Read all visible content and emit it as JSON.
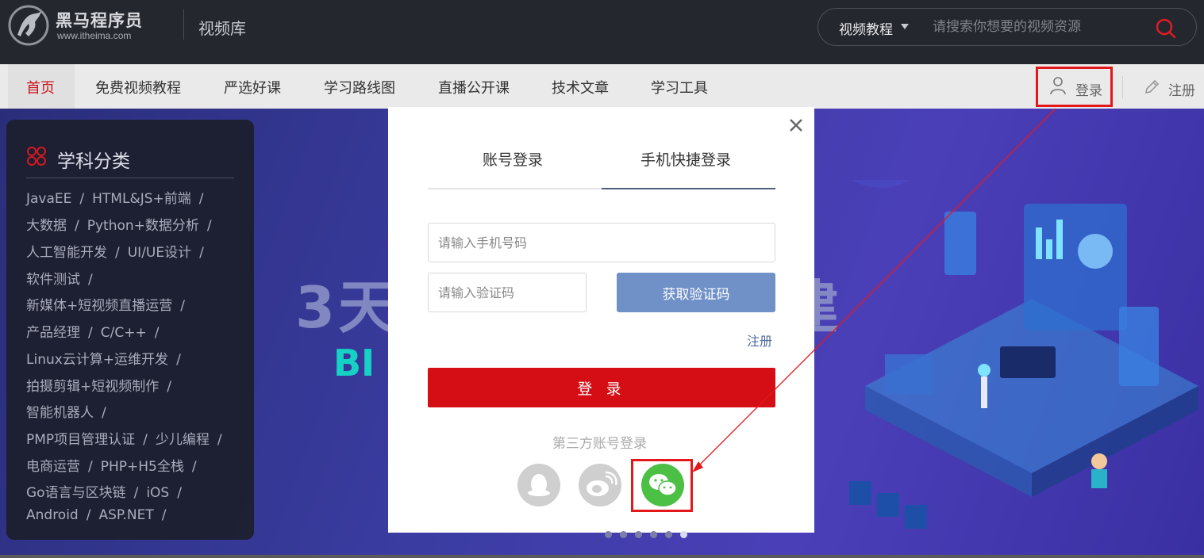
{
  "header": {
    "brand_cn": "黑马程序员",
    "brand_url": "www.itheima.com",
    "section_title": "视频库",
    "search": {
      "category": "视频教程",
      "placeholder": "请搜索你想要的视频资源"
    }
  },
  "nav": {
    "items": [
      "首页",
      "免费视频教程",
      "严选好课",
      "学习路线图",
      "直播公开课",
      "技术文章",
      "学习工具"
    ],
    "active": "首页",
    "login": "登录",
    "register": "注册"
  },
  "sidebar": {
    "title": "学科分类",
    "lines": [
      [
        "JavaEE",
        "HTML&JS+前端"
      ],
      [
        "大数据",
        "Python+数据分析"
      ],
      [
        "人工智能开发",
        "UI/UE设计"
      ],
      [
        "软件测试"
      ],
      [
        "新媒体+短视频直播运营"
      ],
      [
        "产品经理",
        "C/C++"
      ],
      [
        "Linux云计算+运维开发"
      ],
      [
        "拍摄剪辑+短视频制作"
      ],
      [
        "智能机器人"
      ],
      [
        "PMP项目管理认证",
        "少儿编程"
      ],
      [
        "电商运营",
        "PHP+H5全栈"
      ],
      [
        "Go语言与区块链",
        "iOS"
      ],
      [
        "Android",
        "ASP.NET"
      ]
    ]
  },
  "banner": {
    "text1": "3天",
    "text2": "BI",
    "text3": "建"
  },
  "modal": {
    "tabs": [
      "账号登录",
      "手机快捷登录"
    ],
    "active_tab": "手机快捷登录",
    "phone_placeholder": "请输入手机号码",
    "code_placeholder": "请输入验证码",
    "get_code_label": "获取验证码",
    "register_label": "注册",
    "login_label": "登 录",
    "third_party_label": "第三方账号登录",
    "social_icons": [
      "qq-icon",
      "weibo-icon",
      "wechat-icon"
    ]
  },
  "colors": {
    "primary_red": "#d50d14",
    "get_code_blue": "#7090c8",
    "wechat_green": "#4cbf45",
    "highlight_red": "#e4181b"
  }
}
